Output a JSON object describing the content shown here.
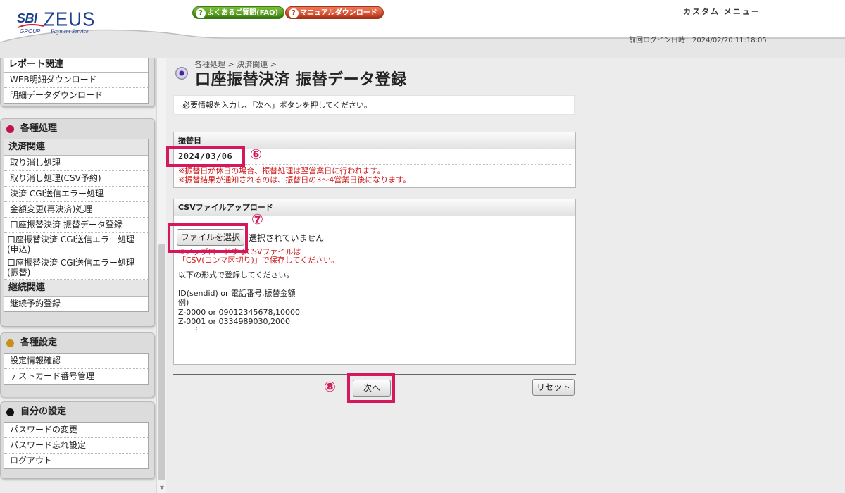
{
  "header": {
    "logo": {
      "sbi": "SBI",
      "zeus": "ZEUS",
      "group": "GROUP",
      "payment_service": "Payment Service"
    },
    "faq_button": "よくあるご質問(FAQ)",
    "manual_button": "マニュアルダウンロード",
    "question_glyph": "?",
    "custom_menu": "カスタム メニュー",
    "last_login": "前回ログイン日時：2024/02/20 11:18:05"
  },
  "sidebar": {
    "report": {
      "title": "レポート関連",
      "items": [
        "WEB明細ダウンロード",
        "明細データダウンロード"
      ]
    },
    "processing": {
      "title": "各種処理",
      "dot_color": "#c0134a",
      "category1": "決済関連",
      "items": [
        "取り消し処理",
        "取り消し処理(CSV予約)",
        "決済 CGI送信エラー処理",
        "金額変更(再決済)処理",
        "口座振替決済 振替データ登録",
        "口座振替決済 CGI送信エラー処理(申込)",
        "口座振替決済 CGI送信エラー処理(振替)"
      ],
      "category2": "継続関連",
      "items2": [
        "継続予約登録"
      ]
    },
    "settings": {
      "title": "各種設定",
      "dot_color": "#c8901a",
      "items": [
        "設定情報確認",
        "テストカード番号管理"
      ]
    },
    "my_settings": {
      "title": "自分の設定",
      "dot_color": "#111111",
      "items": [
        "パスワードの変更",
        "パスワード忘れ設定",
        "ログアウト"
      ]
    },
    "scroll_arrow": "▼"
  },
  "main": {
    "breadcrumb": "各種処理 > 決済関連 >",
    "title": "口座振替決済 振替データ登録",
    "instruction": "必要情報を入力し、「次へ」ボタンを押してください。",
    "transfer_date": {
      "label": "振替日",
      "value": "2024/03/06",
      "note1": "※振替日が休日の場合、振替処理は翌営業日に行われます。",
      "note2": "※振替結果が通知されるのは、振替日の3～4営業日後になります。"
    },
    "csv_upload": {
      "label": "CSVファイルアップロード",
      "file_button": "ファイルを選択",
      "no_file": "選択されていません",
      "note1": "※アップロードするCSVファイルは",
      "note2": "「CSV(コンマ区切り)」で保存してください。",
      "format_intro": "以下の形式で登録してください。",
      "format_header": "ID(sendid) or 電話番号,振替金額",
      "example_label": "例)",
      "example1": "Z-0000 or 09012345678,10000",
      "example2": "Z-0001 or 0334989030,2000",
      "vertical_dots": "⋮"
    },
    "next_button": "次へ",
    "reset_button": "リセット"
  },
  "annotations": {
    "color": "#d5175d",
    "marker6": "⑥",
    "marker7": "⑦",
    "marker8": "⑧"
  }
}
